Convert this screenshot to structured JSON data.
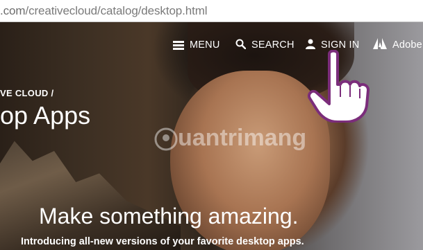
{
  "browser": {
    "url_host_fragment": ".com",
    "url_path": "/creativecloud/catalog/desktop.html"
  },
  "nav": {
    "menu_label": "MENU",
    "search_label": "SEARCH",
    "signin_label": "SIGN IN",
    "adobe_label": "Adobe"
  },
  "hero": {
    "breadcrumb": "VE CLOUD /",
    "title": "op Apps",
    "headline": "Make something amazing.",
    "subheadline": "Introducing all-new versions of your favorite desktop apps."
  },
  "watermark": {
    "text": "uantrimang"
  },
  "colors": {
    "hero_text": "#ffffff",
    "url_text": "#7a7a7a",
    "hand_outline": "#7b2d7b"
  }
}
